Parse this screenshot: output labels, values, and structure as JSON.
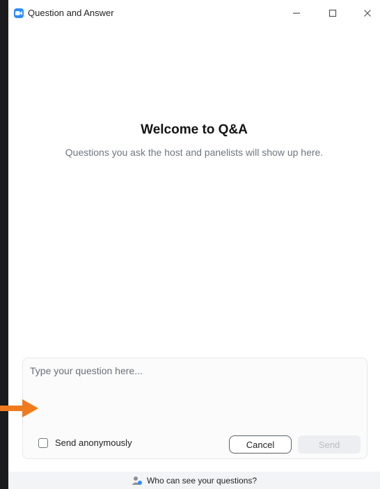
{
  "window": {
    "title": "Question and Answer"
  },
  "titlebar": {
    "minimize_glyph": "–",
    "maximize_glyph": "☐",
    "close_glyph": "✕"
  },
  "main": {
    "welcome_title": "Welcome to Q&A",
    "welcome_subtitle": "Questions you ask the host and panelists will show up here."
  },
  "compose": {
    "placeholder": "Type your question here...",
    "value": "",
    "anonymous_label": "Send anonymously",
    "anonymous_checked": false,
    "cancel_label": "Cancel",
    "send_label": "Send"
  },
  "footer": {
    "text": "Who can see your questions?"
  },
  "icons": {
    "app": "zoom-camera-icon",
    "footer": "users-icon",
    "annotation": "orange-arrow-icon"
  },
  "colors": {
    "brand": "#2d8cff",
    "arrow": "#f07a1e",
    "send_disabled_bg": "#eceef1"
  }
}
